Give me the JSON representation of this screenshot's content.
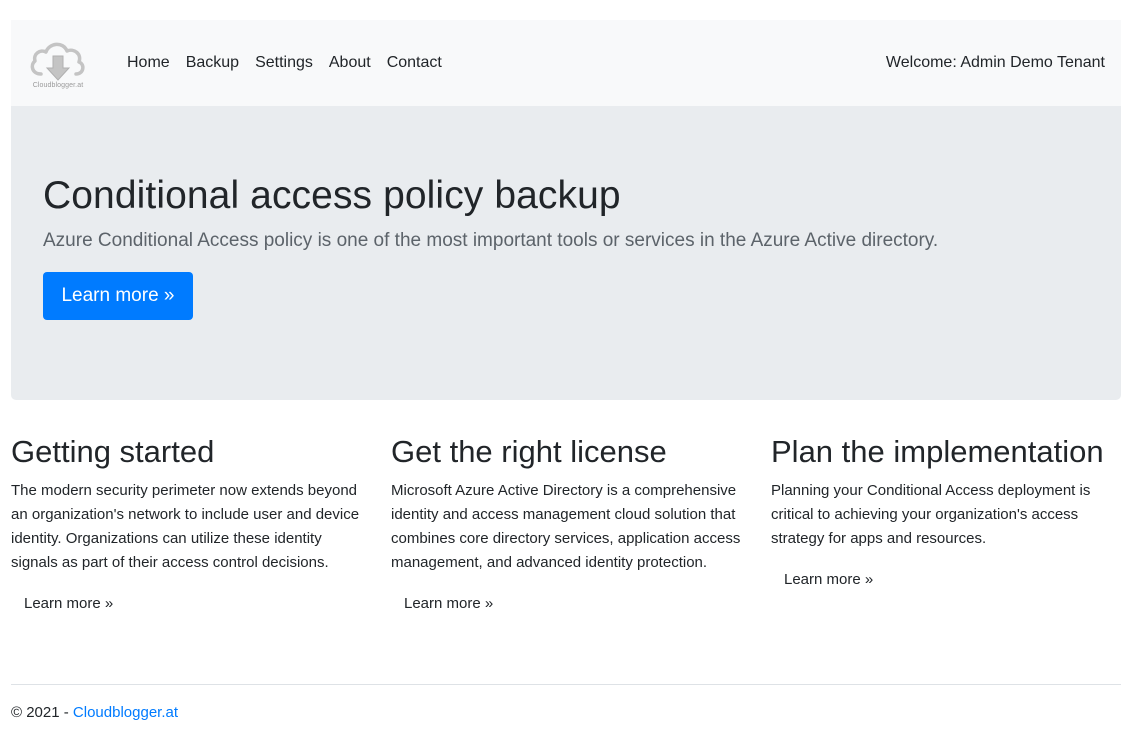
{
  "navbar": {
    "logo_text": "Cloudblogger.at",
    "links": [
      "Home",
      "Backup",
      "Settings",
      "About",
      "Contact"
    ],
    "welcome": "Welcome: Admin Demo Tenant"
  },
  "jumbotron": {
    "title": "Conditional access policy backup",
    "lead": "Azure Conditional Access policy is one of the most important tools or services in the Azure Active directory.",
    "button": "Learn more »"
  },
  "columns": [
    {
      "heading": "Getting started",
      "text": "The modern security perimeter now extends beyond an organization's network to include user and device identity. Organizations can utilize these identity signals as part of their access control decisions.",
      "button": "Learn more »"
    },
    {
      "heading": "Get the right license",
      "text": "Microsoft Azure Active Directory is a comprehensive identity and access management cloud solution that combines core directory services, application access management, and advanced identity protection.",
      "button": "Learn more »"
    },
    {
      "heading": "Plan the implementation",
      "text": "Planning your Conditional Access deployment is critical to achieving your organization's access strategy for apps and resources.",
      "button": "Learn more »"
    }
  ],
  "footer": {
    "copyright": "© 2021 - ",
    "link": "Cloudblogger.at"
  },
  "colors": {
    "primary": "#007bff",
    "navbar_bg": "#f8f9fa",
    "jumbotron_bg": "#e9ecef"
  },
  "icons": {
    "logo": "cloud-download-icon"
  }
}
